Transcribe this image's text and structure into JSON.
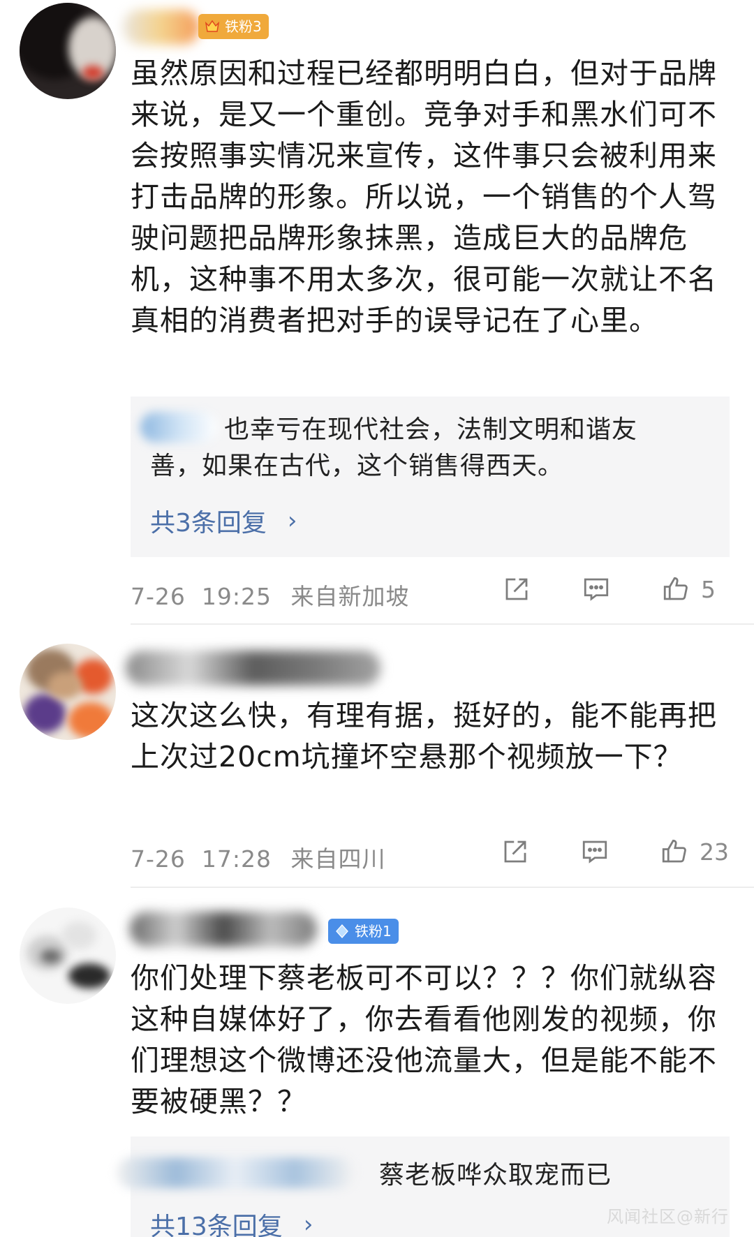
{
  "comments": [
    {
      "badge": "铁粉3",
      "text": "虽然原因和过程已经都明明白白，但对于品牌来说，是又一个重创。竞争对手和黑水们可不会按照事实情况来宣传，这件事只会被利用来打击品牌的形象。所以说，一个销售的个人驾驶问题把品牌形象抹黑，造成巨大的品牌危机，这种事不用太多次，很可能一次就让不名真相的消费者把对手的误导记在了心里。",
      "reply": {
        "text": "也幸亏在现代社会，法制文明和谐友善，如果在古代，这个销售得西天。",
        "more": "共3条回复"
      },
      "time": "7-26  19:25",
      "location": "来自新加坡",
      "likes": "5"
    },
    {
      "text": "这次这么快，有理有据，挺好的，能不能再把上次过20cm坑撞坏空悬那个视频放一下？",
      "time": "7-26  17:28",
      "location": "来自四川",
      "likes": "23"
    },
    {
      "badge": "铁粉1",
      "text": "你们处理下蔡老板可不可以？？？你们就纵容这种自媒体好了，你去看看他刚发的视频，你们理想这个微博还没他流量大，但是能不能不要被硬黑？？",
      "reply": {
        "text": "蔡老板哗众取宠而已",
        "more": "共13条回复"
      }
    }
  ],
  "icons": {
    "share": "share-icon",
    "comment": "comment-icon",
    "like": "thumbs-up-icon",
    "chevron": "chevron-right-icon"
  },
  "colors": {
    "badge_gold": "#f0a93b",
    "badge_blue": "#4a8ee8",
    "link": "#4b6fa8",
    "meta": "#8a8a8a"
  },
  "watermark": "风闻社区@新行"
}
